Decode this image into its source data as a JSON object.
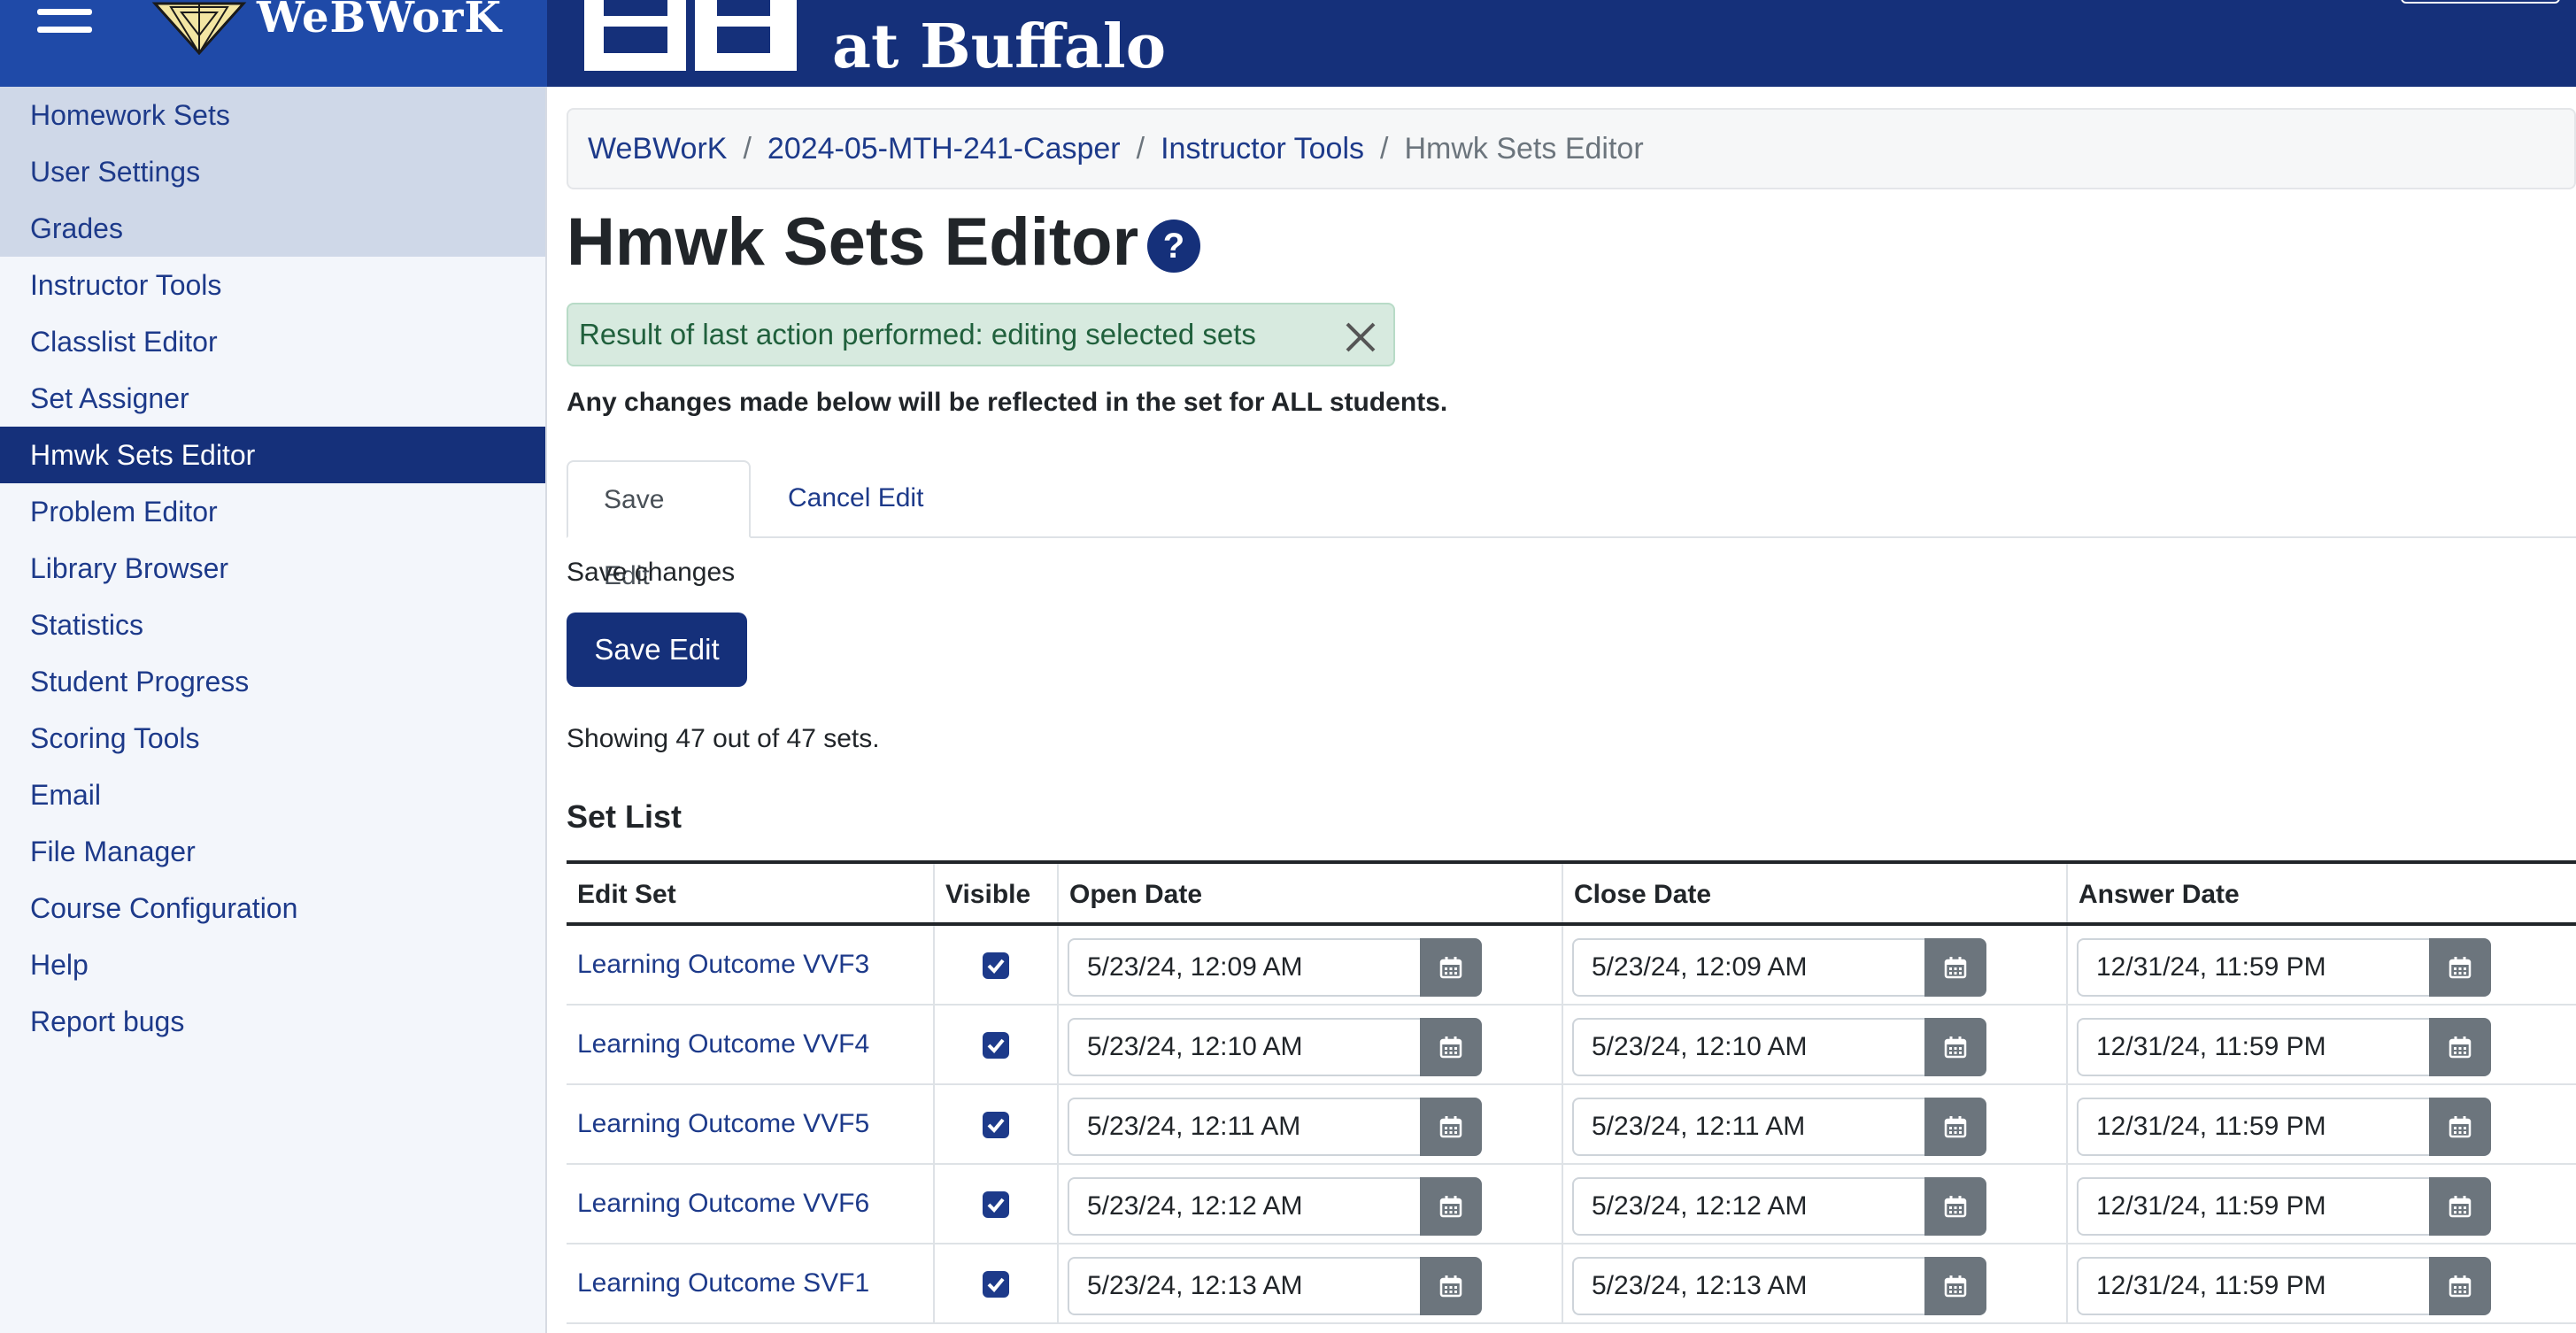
{
  "header": {
    "app_name": "WeBWorK",
    "university_text": "at Buffalo"
  },
  "sidebar": {
    "items": [
      {
        "label": "Homework Sets"
      },
      {
        "label": "User Settings"
      },
      {
        "label": "Grades"
      },
      {
        "label": "Instructor Tools"
      },
      {
        "label": "Classlist Editor"
      },
      {
        "label": "Set Assigner"
      },
      {
        "label": "Hmwk Sets Editor"
      },
      {
        "label": "Problem Editor"
      },
      {
        "label": "Library Browser"
      },
      {
        "label": "Statistics"
      },
      {
        "label": "Student Progress"
      },
      {
        "label": "Scoring Tools"
      },
      {
        "label": "Email"
      },
      {
        "label": "File Manager"
      },
      {
        "label": "Course Configuration"
      },
      {
        "label": "Help"
      },
      {
        "label": "Report bugs"
      }
    ],
    "active": "Hmwk Sets Editor"
  },
  "breadcrumb": {
    "items": [
      "WeBWorK",
      "2024-05-MTH-241-Casper",
      "Instructor Tools"
    ],
    "current": "Hmwk Sets Editor",
    "separator": "/"
  },
  "page": {
    "title": "Hmwk Sets Editor",
    "help_icon": "?",
    "alert": "Result of last action performed: editing selected sets",
    "notice": "Any changes made below will be reflected in the set for ALL students.",
    "tabs": [
      {
        "label": "Save Edit"
      },
      {
        "label": "Cancel Edit"
      }
    ],
    "save_changes_label": "Save changes",
    "save_button": "Save Edit",
    "showing": "Showing 47 out of 47 sets.",
    "set_list_title": "Set List"
  },
  "table": {
    "headers": [
      "Edit Set",
      "Visible",
      "Open Date",
      "Close Date",
      "Answer Date"
    ],
    "rows": [
      {
        "name": "Learning Outcome VVF3",
        "visible": true,
        "open": "5/23/24, 12:09 AM",
        "close": "5/23/24, 12:09 AM",
        "answer": "12/31/24, 11:59 PM"
      },
      {
        "name": "Learning Outcome VVF4",
        "visible": true,
        "open": "5/23/24, 12:10 AM",
        "close": "5/23/24, 12:10 AM",
        "answer": "12/31/24, 11:59 PM"
      },
      {
        "name": "Learning Outcome VVF5",
        "visible": true,
        "open": "5/23/24, 12:11 AM",
        "close": "5/23/24, 12:11 AM",
        "answer": "12/31/24, 11:59 PM"
      },
      {
        "name": "Learning Outcome VVF6",
        "visible": true,
        "open": "5/23/24, 12:12 AM",
        "close": "5/23/24, 12:12 AM",
        "answer": "12/31/24, 11:59 PM"
      },
      {
        "name": "Learning Outcome SVF1",
        "visible": true,
        "open": "5/23/24, 12:13 AM",
        "close": "5/23/24, 12:13 AM",
        "answer": "12/31/24, 11:59 PM"
      }
    ]
  },
  "colors": {
    "brand_dark": "#15307a",
    "brand_light": "#1f4aa8",
    "link": "#1d3a8a",
    "alert_bg": "#d7eadf"
  }
}
